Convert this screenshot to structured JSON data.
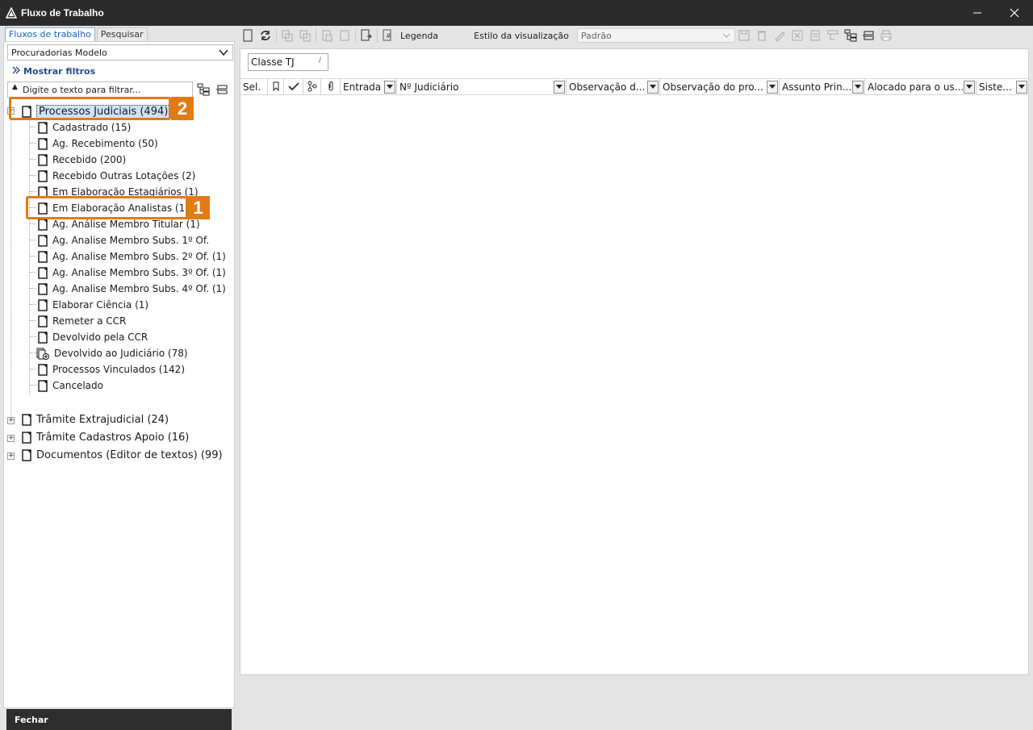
{
  "window": {
    "title": "Fluxo de Trabalho",
    "minimize": "—",
    "close": "✕"
  },
  "left": {
    "tabs": [
      {
        "label": "Fluxos de trabalho"
      },
      {
        "label": "Pesquisar"
      }
    ],
    "model_select": "Procuradorias Modelo",
    "show_filters": "Mostrar filtros",
    "filter_placeholder": "Digite o texto para filtrar...",
    "tree": {
      "root_expanded": {
        "label": "Processos Judiciais (494)"
      },
      "children": [
        "Cadastrado (15)",
        "Ag. Recebimento (50)",
        "Recebido (200)",
        "Recebido Outras Lotações (2)",
        "Em Elaboração Estagiários (1)",
        "Em Elaboração Analistas (1)",
        "Ag. Análise Membro Titular (1)",
        "Ag. Analise Membro Subs. 1º Of.",
        "Ag. Analise Membro Subs. 2º Of. (1)",
        "Ag. Analise Membro Subs. 3º Of. (1)",
        "Ag. Analise Membro Subs. 4º Of. (1)",
        "Elaborar Ciência (1)",
        "Remeter a CCR",
        "Devolvido pela CCR",
        "Devolvido ao Judiciário (78)",
        "Processos Vinculados (142)",
        "Cancelado"
      ],
      "collapsed_roots": [
        "Trâmite Extrajudicial (24)",
        "Trâmite Cadastros Apoio (16)",
        "Documentos (Editor de textos) (99)"
      ]
    },
    "callouts": [
      {
        "number": "1"
      },
      {
        "number": "2"
      }
    ],
    "close_button": "Fechar"
  },
  "main": {
    "toolbar": {
      "legend": "Legenda",
      "view_style_label": "Estilo da visualização",
      "view_style_value": "Padrão"
    },
    "group_chip": "Classe TJ",
    "columns": [
      "Sel.",
      "",
      "",
      "",
      "",
      "Entrada",
      "Nº Judiciário",
      "Observação d...",
      "Observação do pro...",
      "Assunto Prin...",
      "Alocado para o us...",
      "Siste..."
    ]
  },
  "colors": {
    "titlebar": "#2b2b2b",
    "callout": "#e07b16",
    "selection": "#cfe3fb",
    "link": "#1f4e8c"
  }
}
